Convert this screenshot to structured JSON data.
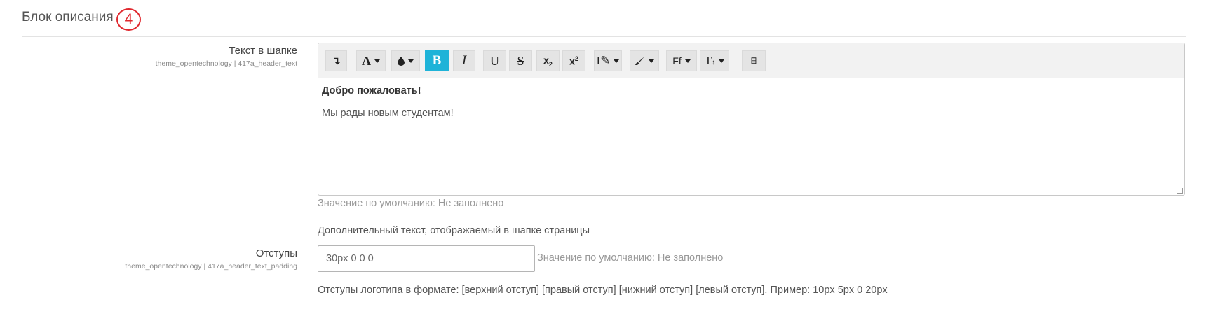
{
  "section": {
    "title": "Блок описания",
    "badge": "4"
  },
  "header_text_field": {
    "label": "Текст в шапке",
    "setting_id": "theme_opentechnology | 417a_header_text",
    "content_line1": "Добро пожаловать!",
    "content_line2": "Мы рады новым студентам!",
    "default_note": "Значение по умолчанию: Не заполнено",
    "description": "Дополнительный текст, отображаемый в шапке страницы"
  },
  "toolbar": {
    "buttons": [
      {
        "name": "collapse-toggle-button",
        "icon": "arrow-down-hook-icon",
        "glyph": "↴"
      },
      {
        "name": "font-style-button",
        "icon": "font-icon",
        "glyph": "A"
      },
      {
        "name": "font-color-button",
        "icon": "droplet-icon",
        "glyph": "💧"
      },
      {
        "name": "bold-button",
        "icon": "bold-icon",
        "glyph": "B"
      },
      {
        "name": "italic-button",
        "icon": "italic-icon",
        "glyph": "I"
      },
      {
        "name": "underline-button",
        "icon": "underline-icon",
        "glyph": "U"
      },
      {
        "name": "strikethrough-button",
        "icon": "strikethrough-icon",
        "glyph": "S"
      },
      {
        "name": "subscript-button",
        "icon": "subscript-icon",
        "glyph": "x₂"
      },
      {
        "name": "superscript-button",
        "icon": "superscript-icon",
        "glyph": "x²"
      },
      {
        "name": "text-format-button",
        "icon": "pen-icon",
        "glyph": "I✎"
      },
      {
        "name": "brush-button",
        "icon": "brush-icon",
        "glyph": "🖌"
      },
      {
        "name": "font-family-button",
        "icon": "font-family-icon",
        "glyph": "Ff"
      },
      {
        "name": "font-size-button",
        "icon": "font-size-icon",
        "glyph": "T↕"
      },
      {
        "name": "html-source-button",
        "icon": "code-icon",
        "glyph": "⚯"
      }
    ],
    "active_color": "#1fb3d8"
  },
  "padding_field": {
    "label": "Отступы",
    "setting_id": "theme_opentechnology | 417a_header_text_padding",
    "value": "30px 0 0 0",
    "default_note": "Значение по умолчанию: Не заполнено",
    "description": "Отступы логотипа в формате: [верхний отступ] [правый отступ] [нижний отступ] [левый отступ]. Пример: 10px 5px 0 20px"
  },
  "colors": {
    "badge": "#e0282e",
    "active_button": "#1fb3d8"
  }
}
